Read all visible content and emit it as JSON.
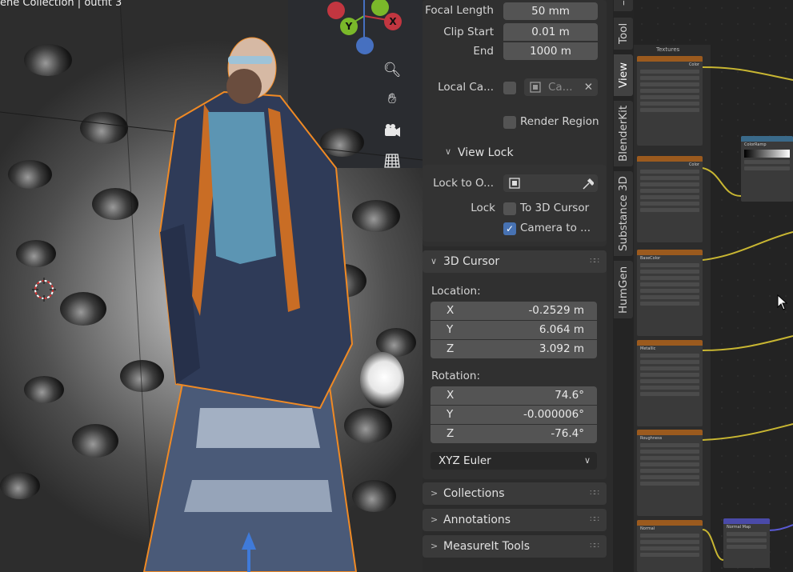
{
  "viewport": {
    "title": "ene Collection | outfit 3",
    "gizmo": {
      "y": "Y",
      "x": "X"
    },
    "nav_icons": [
      "zoom-icon",
      "hand-pan-icon",
      "camera-icon",
      "grid-ortho-icon"
    ]
  },
  "npanel": {
    "focal_length": {
      "label": "Focal Length",
      "value": "50 mm"
    },
    "clip_start": {
      "label": "Clip Start",
      "value": "0.01 m"
    },
    "clip_end": {
      "label": "End",
      "value": "1000 m"
    },
    "local_camera": {
      "label": "Local Ca...",
      "value": "Ca..."
    },
    "render_region": {
      "label": "Render Region"
    },
    "view_lock": {
      "header": "View Lock",
      "lock_to_object": {
        "label": "Lock to O..."
      },
      "lock_label": "Lock",
      "to_3d_cursor": "To 3D Cursor",
      "camera_to_view": "Camera to ..."
    },
    "cursor": {
      "header": "3D Cursor",
      "location_label": "Location:",
      "location": [
        {
          "axis": "X",
          "value": "-0.2529 m"
        },
        {
          "axis": "Y",
          "value": "6.064 m"
        },
        {
          "axis": "Z",
          "value": "3.092 m"
        }
      ],
      "rotation_label": "Rotation:",
      "rotation": [
        {
          "axis": "X",
          "value": "74.6°"
        },
        {
          "axis": "Y",
          "value": "-0.000006°"
        },
        {
          "axis": "Z",
          "value": "-76.4°"
        }
      ],
      "rotation_mode": "XYZ Euler"
    },
    "collapsed_panels": [
      "Collections",
      "Annotations",
      "MeasureIt Tools"
    ]
  },
  "tabs": [
    "Tool",
    "View",
    "BlenderKit",
    "Substance 3D",
    "HumGen"
  ],
  "nodes": {
    "frame_label": "Textures",
    "node_titles": [
      "Color",
      "BaseColor",
      "Metallic",
      "Roughness",
      "Normal"
    ],
    "colorramp": "ColorRamp",
    "normal_map": "Normal Map"
  },
  "colors": {
    "accent": "#4772b3",
    "selection_outline": "#f08a24",
    "wire": "#c8b632"
  }
}
